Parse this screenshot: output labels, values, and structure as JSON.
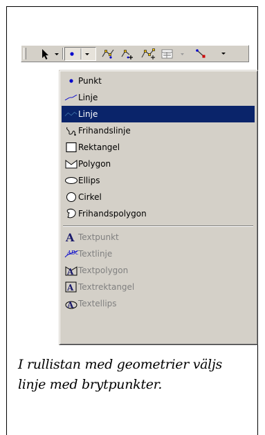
{
  "toolbar": {
    "buttons": [
      {
        "name": "select-tool",
        "icon": "arrow-pointer-icon",
        "has_dropdown": true
      },
      {
        "name": "geometry-type",
        "icon": "point-dot-icon",
        "has_dropdown": true
      },
      {
        "name": "tool-3",
        "icon": "edit-vertices-icon"
      },
      {
        "name": "tool-4",
        "icon": "add-vertex-icon"
      },
      {
        "name": "tool-5",
        "icon": "move-vertices-icon"
      },
      {
        "name": "tool-6",
        "icon": "attribute-table-icon",
        "has_dropdown": true
      },
      {
        "name": "tool-7",
        "icon": "line-node-icon",
        "has_dropdown": true
      }
    ]
  },
  "menu": {
    "items": [
      {
        "label": "Punkt",
        "icon": "point-icon",
        "state": "normal"
      },
      {
        "label": "Linje",
        "icon": "line-curve-icon",
        "state": "normal"
      },
      {
        "label": "Linje",
        "icon": "line-vertices-icon",
        "state": "selected"
      },
      {
        "label": "Frihandslinje",
        "icon": "freehand-line-icon",
        "state": "normal"
      },
      {
        "label": "Rektangel",
        "icon": "rectangle-icon",
        "state": "normal"
      },
      {
        "label": "Polygon",
        "icon": "polygon-icon",
        "state": "normal"
      },
      {
        "label": "Ellips",
        "icon": "ellipse-icon",
        "state": "normal"
      },
      {
        "label": "Cirkel",
        "icon": "circle-icon",
        "state": "normal"
      },
      {
        "label": "Frihandspolygon",
        "icon": "freehand-polygon-icon",
        "state": "normal"
      },
      {
        "label": "Textpunkt",
        "icon": "text-point-icon",
        "state": "disabled"
      },
      {
        "label": "Textlinje",
        "icon": "text-line-icon",
        "state": "disabled"
      },
      {
        "label": "Textpolygon",
        "icon": "text-polygon-icon",
        "state": "disabled"
      },
      {
        "label": "Textrektangel",
        "icon": "text-rectangle-icon",
        "state": "disabled"
      },
      {
        "label": "Textellips",
        "icon": "text-ellipse-icon",
        "state": "disabled"
      }
    ]
  },
  "caption": {
    "line1": "I rullistan med geometrier väljs",
    "line2": "linje med brytpunkter."
  },
  "colors": {
    "menu_bg": "#d4d0c8",
    "selection_bg": "#0a246a",
    "accent_blue": "#0000cc",
    "disabled_text": "#808080"
  }
}
